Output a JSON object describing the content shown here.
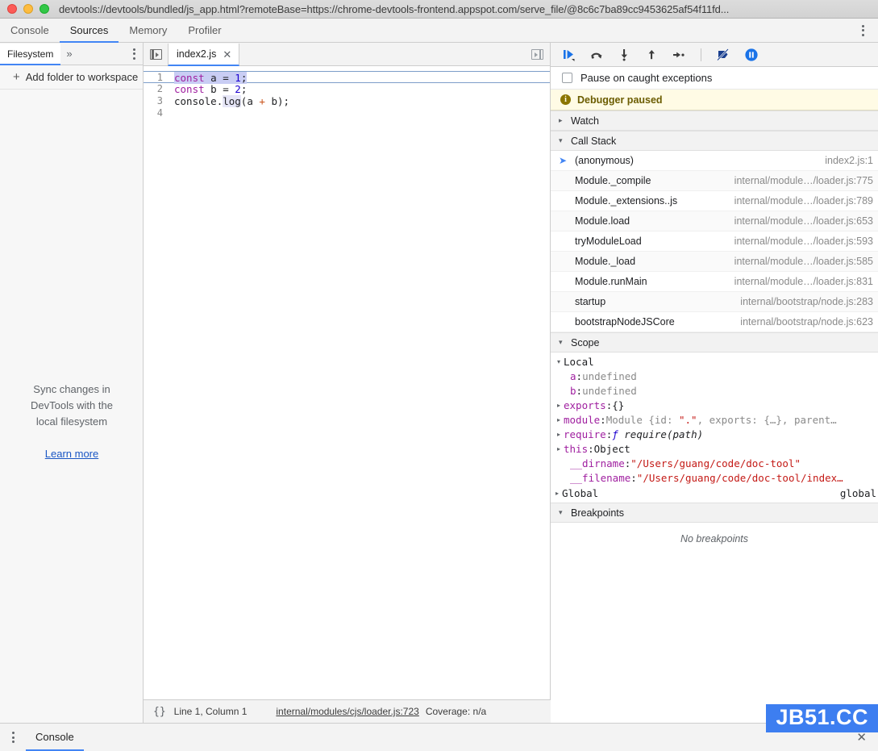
{
  "window": {
    "title": "devtools://devtools/bundled/js_app.html?remoteBase=https://chrome-devtools-frontend.appspot.com/serve_file/@8c6c7ba89cc9453625af54f11fd...",
    "traffic_colors": {
      "close": "#fc5b57",
      "minimize": "#fdbc40",
      "maximize": "#33c748"
    }
  },
  "main_tabs": [
    {
      "label": "Console",
      "active": false
    },
    {
      "label": "Sources",
      "active": true
    },
    {
      "label": "Memory",
      "active": false
    },
    {
      "label": "Profiler",
      "active": false
    }
  ],
  "main_tabbar": {
    "kebab_icon": "kebab-menu-icon"
  },
  "nav_panel": {
    "tabs": [
      {
        "label": "Filesystem",
        "active": true
      }
    ],
    "more_label": "»",
    "kebab_icon": "kebab-menu-icon",
    "add_folder_label": "Add folder to workspace",
    "add_folder_plus": "+",
    "empty_lines": [
      "Sync changes in",
      "DevTools with the",
      "local filesystem"
    ],
    "learn_more_label": "Learn more"
  },
  "editor": {
    "nav_toggle_icon": "show-navigator-icon",
    "panel_toggle_icon": "show-debugger-icon",
    "file_tab": {
      "label": "index2.js",
      "close_glyph": "✕"
    },
    "lines": [
      {
        "num": "1",
        "text": "const a = 1;",
        "executing": true
      },
      {
        "num": "2",
        "text": "const b = 2;",
        "executing": false
      },
      {
        "num": "3",
        "text": "console.log(a + b);",
        "executing": false
      },
      {
        "num": "4",
        "text": "",
        "executing": false
      }
    ],
    "status": {
      "braces_icon": "pretty-print-icon",
      "braces_label": "{}",
      "position": "Line 1, Column 1",
      "link": "internal/modules/cjs/loader.js:723",
      "coverage": "Coverage: n/a"
    }
  },
  "debugger": {
    "toolbar_buttons": [
      {
        "name": "resume-button",
        "title": "Resume script execution"
      },
      {
        "name": "step-over-button",
        "title": "Step over next function call"
      },
      {
        "name": "step-into-button",
        "title": "Step into next function call"
      },
      {
        "name": "step-out-button",
        "title": "Step out of current function"
      },
      {
        "name": "step-button",
        "title": "Step"
      },
      {
        "name": "deactivate-breakpoints-button",
        "title": "Deactivate breakpoints"
      },
      {
        "name": "pause-on-exceptions-button",
        "title": "Pause on exceptions"
      }
    ],
    "pause_on_caught": {
      "label": "Pause on caught exceptions",
      "checked": false
    },
    "paused_banner": {
      "text": "Debugger paused",
      "icon": "info-icon",
      "bg": "#fffbe5",
      "fg": "#6b5c00"
    },
    "watch": {
      "label": "Watch",
      "expanded": false,
      "triangle": "▸"
    },
    "call_stack": {
      "label": "Call Stack",
      "expanded": true,
      "triangle": "▾",
      "frames": [
        {
          "name": "(anonymous)",
          "location": "index2.js:1",
          "selected": true
        },
        {
          "name": "Module._compile",
          "location": "internal/module…/loader.js:775",
          "selected": false
        },
        {
          "name": "Module._extensions..js",
          "location": "internal/module…/loader.js:789",
          "selected": false
        },
        {
          "name": "Module.load",
          "location": "internal/module…/loader.js:653",
          "selected": false
        },
        {
          "name": "tryModuleLoad",
          "location": "internal/module…/loader.js:593",
          "selected": false
        },
        {
          "name": "Module._load",
          "location": "internal/module…/loader.js:585",
          "selected": false
        },
        {
          "name": "Module.runMain",
          "location": "internal/module…/loader.js:831",
          "selected": false
        },
        {
          "name": "startup",
          "location": "internal/bootstrap/node.js:283",
          "selected": false
        },
        {
          "name": "bootstrapNodeJSCore",
          "location": "internal/bootstrap/node.js:623",
          "selected": false
        }
      ]
    },
    "scope": {
      "label": "Scope",
      "expanded": true,
      "triangle": "▾",
      "local_label": "Local",
      "local_triangle": "▾",
      "entries": [
        {
          "triangle": "",
          "key": "a",
          "sep": ": ",
          "value": "undefined",
          "value_kind": "undefined",
          "indent": 2
        },
        {
          "triangle": "",
          "key": "b",
          "sep": ": ",
          "value": "undefined",
          "value_kind": "undefined",
          "indent": 2
        },
        {
          "triangle": "▸",
          "key": "exports",
          "sep": ": ",
          "value": "{}",
          "value_kind": "object",
          "indent": 1
        },
        {
          "triangle": "▸",
          "key": "module",
          "sep": ": ",
          "value": "Module {id: \".\", exports: {…}, parent…",
          "value_kind": "module-preview",
          "indent": 1
        },
        {
          "triangle": "▸",
          "key": "require",
          "sep": ": ",
          "value": "ƒ require(path)",
          "value_kind": "function",
          "indent": 1
        },
        {
          "triangle": "▸",
          "key": "this",
          "sep": ": ",
          "value": "Object",
          "value_kind": "plain",
          "indent": 1
        },
        {
          "triangle": "",
          "key": "__dirname",
          "sep": ": ",
          "value": "\"/Users/guang/code/doc-tool\"",
          "value_kind": "string",
          "indent": 2
        },
        {
          "triangle": "",
          "key": "__filename",
          "sep": ": ",
          "value": "\"/Users/guang/code/doc-tool/index…",
          "value_kind": "string",
          "indent": 2
        }
      ],
      "global": {
        "triangle": "▸",
        "label": "Global",
        "value": "global"
      }
    },
    "breakpoints": {
      "label": "Breakpoints",
      "expanded": true,
      "triangle": "▾",
      "empty_text": "No breakpoints"
    }
  },
  "drawer": {
    "kebab_icon": "kebab-menu-icon",
    "tab_label": "Console",
    "close_glyph": "✕"
  },
  "watermark": {
    "text": "JB51.CC",
    "bg": "#3d7ef0",
    "fg": "#ffffff"
  },
  "accent": {
    "blue": "#4285f4",
    "link": "#1a56c4"
  }
}
